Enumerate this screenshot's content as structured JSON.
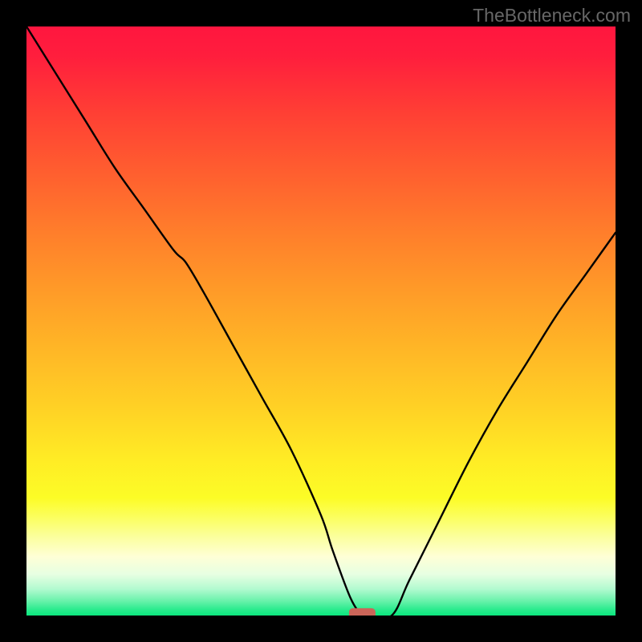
{
  "watermark": "TheBottleneck.com",
  "chart_data": {
    "type": "line",
    "title": "",
    "xlabel": "",
    "ylabel": "",
    "xlim": [
      0,
      100
    ],
    "ylim": [
      0,
      100
    ],
    "grid": false,
    "legend": false,
    "background": {
      "type": "vertical-gradient",
      "stops": [
        {
          "offset": 0.0,
          "color": "#ff163f"
        },
        {
          "offset": 0.05,
          "color": "#ff1e3d"
        },
        {
          "offset": 0.15,
          "color": "#ff4034"
        },
        {
          "offset": 0.25,
          "color": "#ff5f2f"
        },
        {
          "offset": 0.35,
          "color": "#ff7e2b"
        },
        {
          "offset": 0.45,
          "color": "#ff9b28"
        },
        {
          "offset": 0.55,
          "color": "#ffb726"
        },
        {
          "offset": 0.65,
          "color": "#ffd225"
        },
        {
          "offset": 0.74,
          "color": "#ffed25"
        },
        {
          "offset": 0.8,
          "color": "#fcfc26"
        },
        {
          "offset": 0.835,
          "color": "#fbff62"
        },
        {
          "offset": 0.865,
          "color": "#fbff9b"
        },
        {
          "offset": 0.9,
          "color": "#feffd6"
        },
        {
          "offset": 0.93,
          "color": "#e7ffe2"
        },
        {
          "offset": 0.955,
          "color": "#b2fad0"
        },
        {
          "offset": 0.975,
          "color": "#6af2ab"
        },
        {
          "offset": 0.99,
          "color": "#2aeb8d"
        },
        {
          "offset": 1.0,
          "color": "#0be77e"
        }
      ]
    },
    "series": [
      {
        "name": "bottleneck-curve",
        "color": "#000000",
        "x": [
          0,
          5,
          10,
          15,
          20,
          25,
          27,
          30,
          35,
          40,
          45,
          50,
          52,
          55,
          57,
          58,
          62,
          65,
          70,
          75,
          80,
          85,
          90,
          95,
          100
        ],
        "y": [
          100,
          92,
          84,
          76,
          69,
          62,
          60,
          55,
          46,
          37,
          28,
          17,
          11,
          3,
          0,
          0,
          0,
          6,
          16,
          26,
          35,
          43,
          51,
          58,
          65
        ]
      }
    ],
    "marker": {
      "name": "target-marker",
      "shape": "rounded-rect",
      "center_x": 57,
      "center_y": 0,
      "width": 4.5,
      "height": 2.5,
      "color": "#cb6559"
    }
  }
}
